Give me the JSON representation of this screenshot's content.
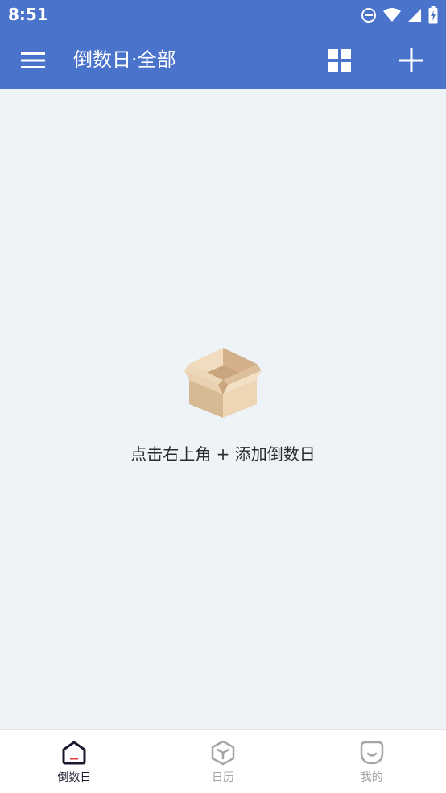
{
  "status_bar": {
    "time": "8:51",
    "icons": [
      "do-not-disturb-icon",
      "wifi-icon",
      "signal-icon",
      "battery-charging-icon"
    ]
  },
  "app_bar": {
    "title": "倒数日·全部",
    "menu_icon": "hamburger-menu-icon",
    "grid_icon": "grid-view-icon",
    "add_icon": "plus-icon",
    "background_color": "#4a74cc"
  },
  "empty_state": {
    "icon": "open-box-icon",
    "message": "点击右上角 + 添加倒数日"
  },
  "bottom_nav": {
    "items": [
      {
        "label": "倒数日",
        "icon": "home-icon",
        "active": true
      },
      {
        "label": "日历",
        "icon": "cube-icon",
        "active": false
      },
      {
        "label": "我的",
        "icon": "smiley-icon",
        "active": false
      }
    ],
    "active_color": "#1a1a2e",
    "inactive_color": "#a5a5a5",
    "accent_color": "#e53935"
  }
}
